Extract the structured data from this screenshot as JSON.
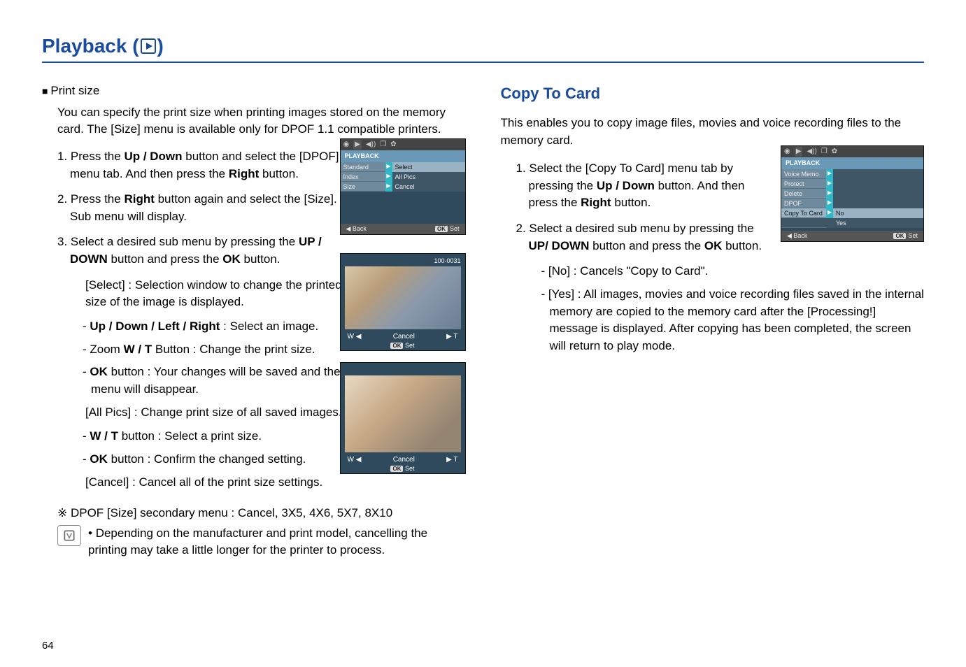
{
  "page": {
    "title_prefix": "Playback (",
    "title_suffix": ")",
    "number": "64"
  },
  "left": {
    "print_size_head": "Print size",
    "intro": "You can specify the print size when printing images stored on the memory card. The [Size] menu is available only for DPOF 1.1 compatible printers.",
    "step1_a": "1. Press the ",
    "step1_b": "Up / Down",
    "step1_c": " button and select the [DPOF] menu tab. And then press the ",
    "step1_d": "Right",
    "step1_e": " button.",
    "step2_a": "2. Press the ",
    "step2_b": "Right",
    "step2_c": " button again and select the [Size]. Sub menu will display.",
    "step3_a": "3. Select a desired sub menu by pressing the ",
    "step3_b": "UP / DOWN",
    "step3_c": " button and press the ",
    "step3_d": "OK",
    "step3_e": " button.",
    "select_a": "[Select] : Selection window to change the printed size of the image is displayed.",
    "select_b_pre": "- ",
    "select_b_bold": "Up / Down / Left / Right",
    "select_b_post": " : Select an image.",
    "select_c_pre": "- Zoom ",
    "select_c_bold": "W / T",
    "select_c_post": " Button : Change the print size.",
    "select_d_pre": "- ",
    "select_d_bold": "OK",
    "select_d_post": " button : Your changes will be saved and the menu will disappear.",
    "allpics": "[All Pics] : Change print size of all saved images.",
    "allpics_b_pre": "- ",
    "allpics_b_bold": "W / T",
    "allpics_b_post": " button : Select a print size.",
    "allpics_c_pre": "- ",
    "allpics_c_bold": "OK",
    "allpics_c_post": " button : Confirm the changed setting.",
    "cancel": "[Cancel] : Cancel all of the print size settings.",
    "footnote1": "※ DPOF [Size] secondary menu : Cancel, 3X5, 4X6, 5X7, 8X10",
    "footnote2": "Depending on the manufacturer and print model, cancelling the printing may take a little longer for the printer to process."
  },
  "right": {
    "title": "Copy To Card",
    "intro": "This enables you to copy image files, movies and voice recording files to the memory card.",
    "step1_a": "1. Select the [Copy To Card] menu tab by pressing the ",
    "step1_b": "Up / Down",
    "step1_c": " button. And then press the ",
    "step1_d": "Right",
    "step1_e": " button.",
    "step2_a": "2. Select a desired sub menu by pressing the ",
    "step2_b": "UP/ DOWN",
    "step2_c": " button and press the ",
    "step2_d": "OK",
    "step2_e": " button.",
    "no": "- [No]  : Cancels \"Copy to Card\".",
    "yes": "- [Yes] : All images, movies and voice recording files saved in the internal memory are copied to the memory card after the [Processing!] message is displayed. After copying has been completed, the screen will return to play mode."
  },
  "menu_left": {
    "header": "PLAYBACK",
    "items": [
      {
        "l": "Standard",
        "r": "Select",
        "sel": true
      },
      {
        "l": "Index",
        "r": "All Pics"
      },
      {
        "l": "Size",
        "r": "Cancel"
      }
    ],
    "back": "Back",
    "ok": "OK",
    "set": "Set"
  },
  "photo_top": {
    "counter": "100-0031",
    "w": "W ◀",
    "cancel": "Cancel",
    "t": "▶ T",
    "ok": "OK",
    "set": "Set"
  },
  "menu_right": {
    "header": "PLAYBACK",
    "items": [
      {
        "l": "Voice Memo",
        "r": ""
      },
      {
        "l": "Protect",
        "r": ""
      },
      {
        "l": "Delete",
        "r": ""
      },
      {
        "l": "DPOF",
        "r": ""
      },
      {
        "l": "Copy To Card",
        "r": "No",
        "hi": true
      },
      {
        "l": "",
        "r": "Yes"
      }
    ],
    "back": "Back",
    "ok": "OK",
    "set": "Set"
  }
}
